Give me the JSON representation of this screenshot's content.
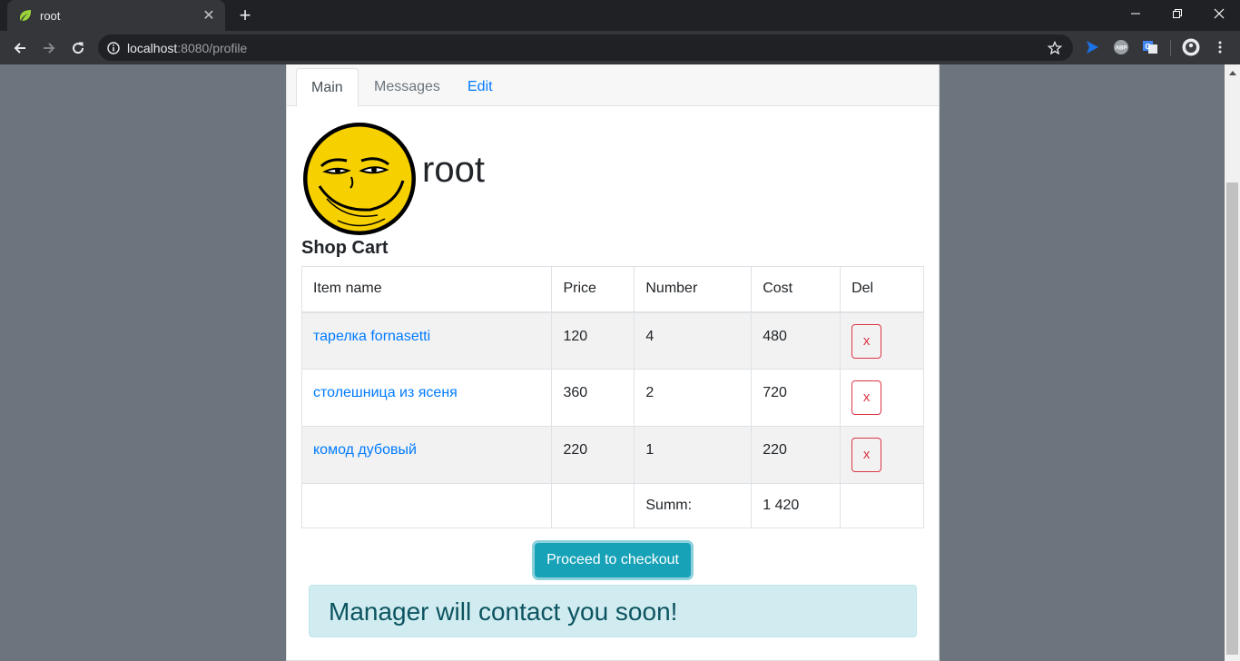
{
  "browser": {
    "tab_title": "root",
    "url_host": "localhost",
    "url_path": ":8080/profile"
  },
  "page": {
    "tabs": [
      {
        "label": "Main"
      },
      {
        "label": "Messages"
      },
      {
        "label": "Edit"
      }
    ],
    "username": "root",
    "cart_title": "Shop Cart",
    "table": {
      "headers": [
        "Item name",
        "Price",
        "Number",
        "Cost",
        "Del"
      ],
      "rows": [
        {
          "name": "тарелка fornasetti",
          "price": "120",
          "number": "4",
          "cost": "480",
          "del": "x"
        },
        {
          "name": "столешница из ясеня",
          "price": "360",
          "number": "2",
          "cost": "720",
          "del": "x"
        },
        {
          "name": "комод дубовый",
          "price": "220",
          "number": "1",
          "cost": "220",
          "del": "x"
        }
      ],
      "sum_label": "Summ:",
      "sum_value": "1 420"
    },
    "checkout_label": "Proceed to checkout",
    "alert_text": "Manager will contact you soon!"
  },
  "icons": {
    "favicon": "spring-leaf-icon",
    "avatar": "smiley-face-avatar"
  },
  "colors": {
    "primary": "#007bff",
    "danger": "#dc3545",
    "info": "#17a2b8",
    "alert_bg": "#d1ecf1",
    "alert_text": "#0c5460",
    "page_bg": "#6c757d"
  }
}
